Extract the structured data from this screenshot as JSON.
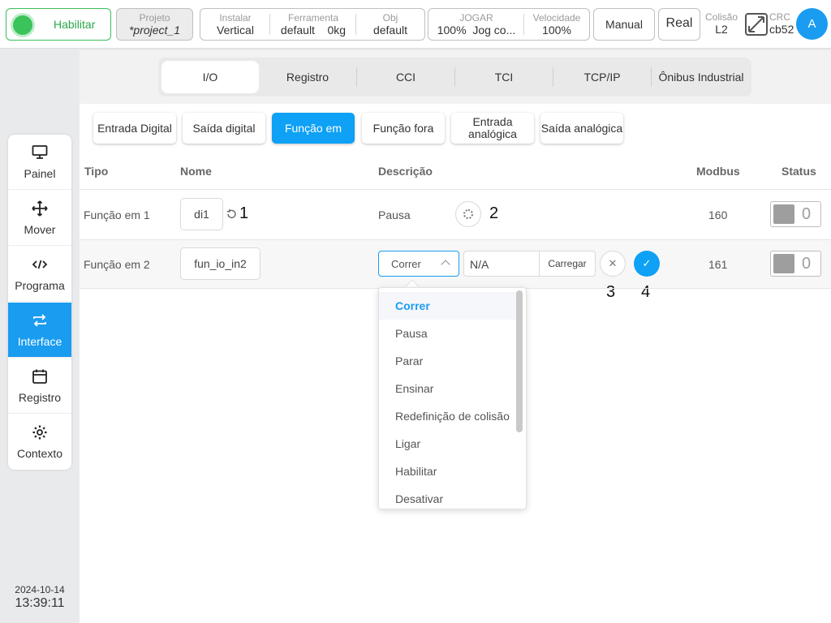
{
  "topbar": {
    "enable_label": "Habilitar",
    "project_label": "Projeto",
    "project_value": "*project_1",
    "install_label": "Instalar",
    "install_value": "Vertical",
    "tool_label": "Ferramenta",
    "tool_value": "default",
    "tool_weight": "0kg",
    "obj_label": "Obj",
    "obj_value": "default",
    "jog_label": "JOGAR",
    "jog_pct": "100%",
    "jog_value": "Jog co...",
    "speed_label": "Velocidade",
    "speed_value": "100%",
    "manual_label": "Manual",
    "real_label": "Real",
    "collision_label": "Colisão",
    "collision_value": "L2",
    "crc_label": "CRC",
    "crc_value": "cb52",
    "avatar_letter": "A"
  },
  "leftnav": {
    "items": [
      {
        "label": "Painel",
        "icon": "monitor-icon"
      },
      {
        "label": "Mover",
        "icon": "move-arrows-icon"
      },
      {
        "label": "Programa",
        "icon": "code-icon"
      },
      {
        "label": "Interface",
        "icon": "swap-arrows-icon"
      },
      {
        "label": "Registro",
        "icon": "calendar-icon"
      },
      {
        "label": "Contexto",
        "icon": "gear-icon"
      }
    ],
    "active_index": 3,
    "date": "2024-10-14",
    "time": "13:39:11"
  },
  "tabs": [
    "I/O",
    "Registro",
    "CCI",
    "TCI",
    "TCP/IP",
    "Ônibus Industrial"
  ],
  "subtabs": {
    "digital_in": "Entrada Digital",
    "digital_out": "Saída digital",
    "func_in": "Função em",
    "func_out": "Função fora",
    "analog_in_1": "Entrada",
    "analog_in_2": "analógica",
    "analog_out": "Saída analógica"
  },
  "table": {
    "headers": {
      "type": "Tipo",
      "name": "Nome",
      "desc": "Descrição",
      "modbus": "Modbus",
      "status": "Status"
    },
    "rows": [
      {
        "type": "Função em 1",
        "name": "di1",
        "desc": "Pausa",
        "modbus": "160",
        "status": "0"
      },
      {
        "type": "Função em 2",
        "name": "fun_io_in2",
        "desc": "Correr",
        "modbus": "161",
        "status": "0"
      }
    ],
    "na_value": "N/A",
    "load_label": "Carregar"
  },
  "annotations": {
    "a1": "1",
    "a2": "2",
    "a3": "3",
    "a4": "4"
  },
  "dropdown": {
    "options": [
      "Correr",
      "Pausa",
      "Parar",
      "Ensinar",
      "Redefinição de colisão",
      "Ligar",
      "Habilitar",
      "Desativar"
    ],
    "selected_index": 0
  },
  "colors": {
    "accent": "#1a9cf0",
    "enable_green": "#3ac35a"
  }
}
